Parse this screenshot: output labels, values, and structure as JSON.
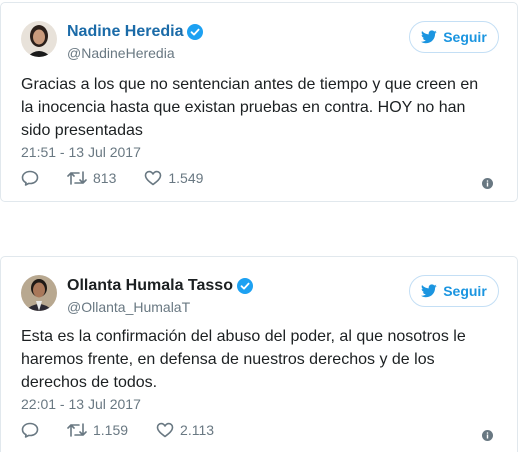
{
  "follow_label": "Seguir",
  "tweets": [
    {
      "name": "Nadine Heredia",
      "handle": "@NadineHeredia",
      "text": "Gracias a los que no sentencian antes de tiempo y que creen en la inocencia hasta que existan pruebas en contra. HOY no han sido presentadas",
      "timestamp": "21:51 - 13 Jul 2017",
      "retweets": "813",
      "likes": "1.549"
    },
    {
      "name": "Ollanta Humala Tasso",
      "handle": "@Ollanta_HumalaT",
      "text": "Esta es la confirmación del abuso del poder, al que nosotros le haremos frente, en defensa de nuestros derechos y de los derechos de todos.",
      "timestamp": "22:01 - 13 Jul 2017",
      "retweets": "1.159",
      "likes": "2.113"
    }
  ],
  "colors": {
    "brand_blue": "#1b95e0",
    "name_link": "#1b6ba8",
    "verified": "#1da1f2",
    "meta_gray": "#697882"
  },
  "icons": [
    "verified-icon",
    "twitter-bird-icon",
    "reply-icon",
    "retweet-icon",
    "like-icon",
    "info-icon"
  ]
}
